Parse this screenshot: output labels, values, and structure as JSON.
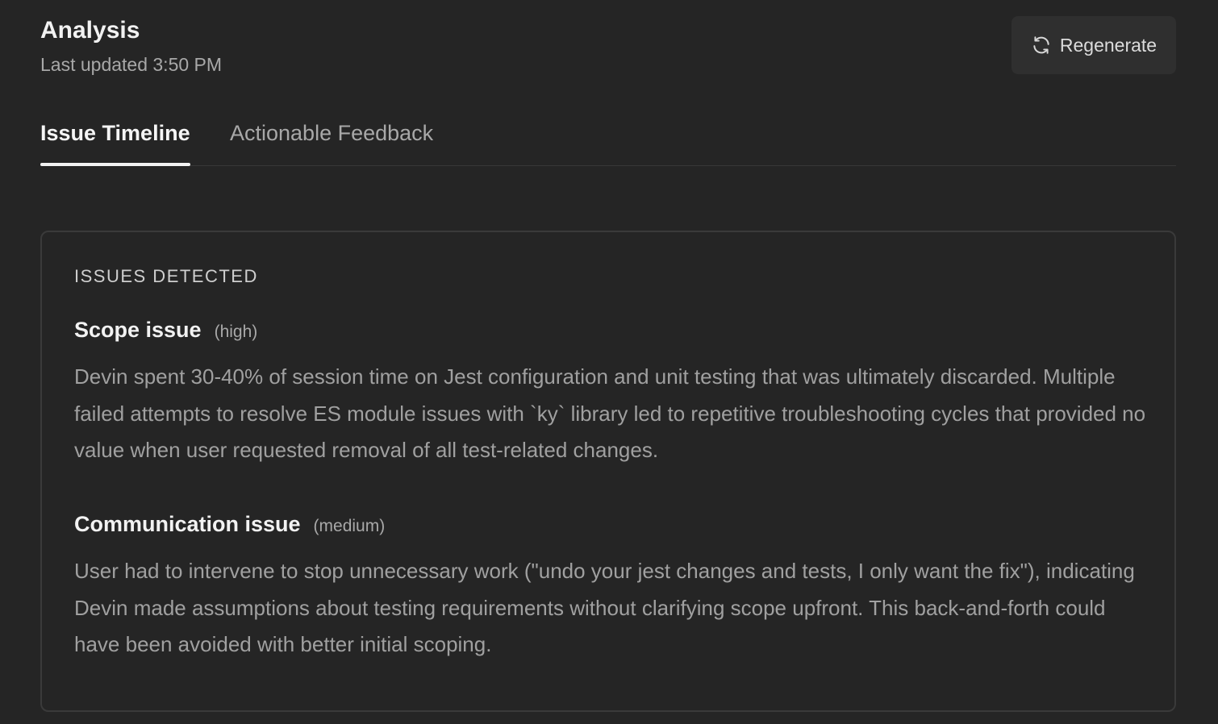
{
  "header": {
    "title": "Analysis",
    "last_updated": "Last updated 3:50 PM",
    "regenerate_label": "Regenerate",
    "regenerate_icon": "refresh-icon"
  },
  "tabs": [
    {
      "label": "Issue Timeline",
      "active": true
    },
    {
      "label": "Actionable Feedback",
      "active": false
    }
  ],
  "issues_section": {
    "heading": "ISSUES DETECTED",
    "issues": [
      {
        "title": "Scope issue",
        "severity": "(high)",
        "description": "Devin spent 30-40% of session time on Jest configuration and unit testing that was ultimately discarded. Multiple failed attempts to resolve ES module issues with `ky` library led to repetitive troubleshooting cycles that provided no value when user requested removal of all test-related changes."
      },
      {
        "title": "Communication issue",
        "severity": "(medium)",
        "description": "User had to intervene to stop unnecessary work (\"undo your jest changes and tests, I only want the fix\"), indicating Devin made assumptions about testing requirements without clarifying scope upfront. This back-and-forth could have been avoided with better initial scoping."
      }
    ]
  }
}
